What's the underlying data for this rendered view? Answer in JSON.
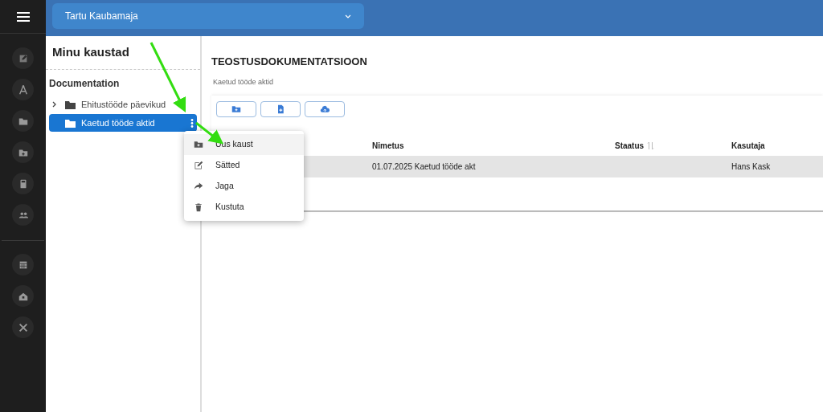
{
  "header": {
    "project_select": "Tartu Kaubamaja"
  },
  "sidebar": {
    "title": "Minu kaustad",
    "section": "Documentation",
    "items": [
      {
        "label": "Ehitustööde päevikud",
        "selected": false,
        "expandable": true
      },
      {
        "label": "Kaetud tööde aktid",
        "selected": true,
        "expandable": false
      }
    ]
  },
  "main": {
    "title": "TEOSTUSDOKUMENTATSIOON",
    "breadcrumb": "Kaetud tööde aktid",
    "table": {
      "columns": [
        {
          "label": "Nimetus",
          "sortable": false
        },
        {
          "label": "Staatus",
          "sortable": true
        },
        {
          "label": "Kasutaja",
          "sortable": false
        }
      ],
      "rows": [
        {
          "cells": [
            "01.07.2025 Kaetud tööde akt",
            "",
            "Hans Kask"
          ],
          "selected": true
        }
      ]
    }
  },
  "context_menu": {
    "items": [
      {
        "label": "Uus kaust",
        "kind": "new-folder",
        "selected": true
      },
      {
        "label": "Sätted",
        "kind": "edit",
        "selected": false
      },
      {
        "label": "Jaga",
        "kind": "share",
        "selected": false
      },
      {
        "label": "Kustuta",
        "kind": "delete",
        "selected": false
      }
    ]
  }
}
